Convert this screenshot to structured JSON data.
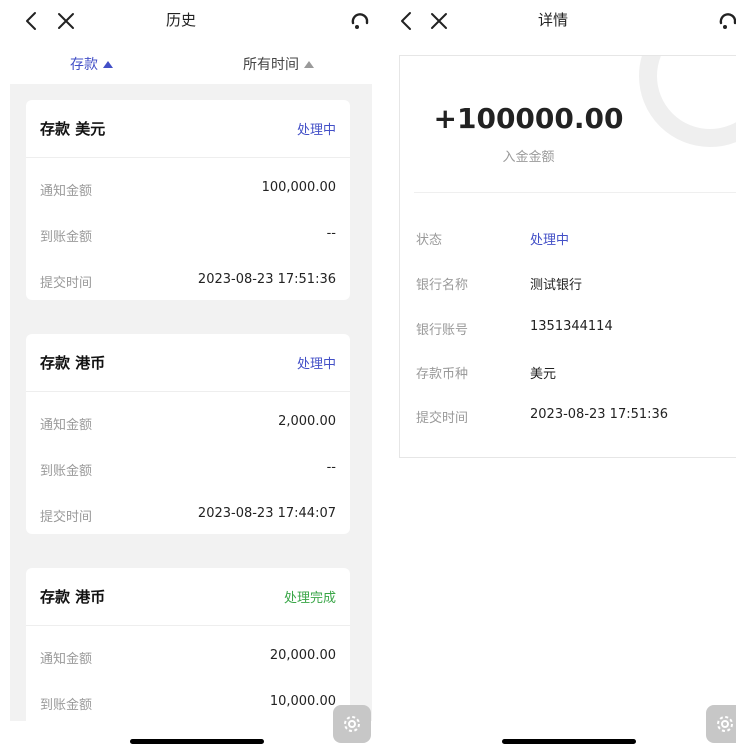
{
  "history": {
    "title": "历史",
    "filters": {
      "type_label": "存款",
      "time_label": "所有时间"
    },
    "cards": [
      {
        "title": "存款 美元",
        "status": "处理中",
        "status_color": "#4350c7",
        "rows": [
          {
            "label": "通知金额",
            "value": "100,000.00"
          },
          {
            "label": "到账金额",
            "value": "--"
          },
          {
            "label": "提交时间",
            "value": "2023-08-23 17:51:36"
          }
        ]
      },
      {
        "title": "存款 港币",
        "status": "处理中",
        "status_color": "#4350c7",
        "rows": [
          {
            "label": "通知金额",
            "value": "2,000.00"
          },
          {
            "label": "到账金额",
            "value": "--"
          },
          {
            "label": "提交时间",
            "value": "2023-08-23 17:44:07"
          }
        ]
      },
      {
        "title": "存款 港币",
        "status": "处理完成",
        "status_color": "#3aa648",
        "rows": [
          {
            "label": "通知金额",
            "value": "20,000.00"
          },
          {
            "label": "到账金额",
            "value": "10,000.00"
          }
        ]
      }
    ]
  },
  "detail": {
    "title": "详情",
    "amount": "+100000.00",
    "amount_label": "入金金额",
    "rows": [
      {
        "label": "状态",
        "value": "处理中"
      },
      {
        "label": "银行名称",
        "value": "测试银行"
      },
      {
        "label": "银行账号",
        "value": "1351344114"
      },
      {
        "label": "存款币种",
        "value": "美元"
      },
      {
        "label": "提交时间",
        "value": "2023-08-23 17:51:36"
      }
    ]
  },
  "colors": {
    "accent": "#4350c7",
    "success": "#3aa648",
    "muted": "#9a9a9a",
    "list_background": "#f2f2f2"
  },
  "icons": {
    "back": "chevron-left-icon",
    "close": "close-icon",
    "support": "support-headset-icon",
    "settings": "gear-icon"
  }
}
